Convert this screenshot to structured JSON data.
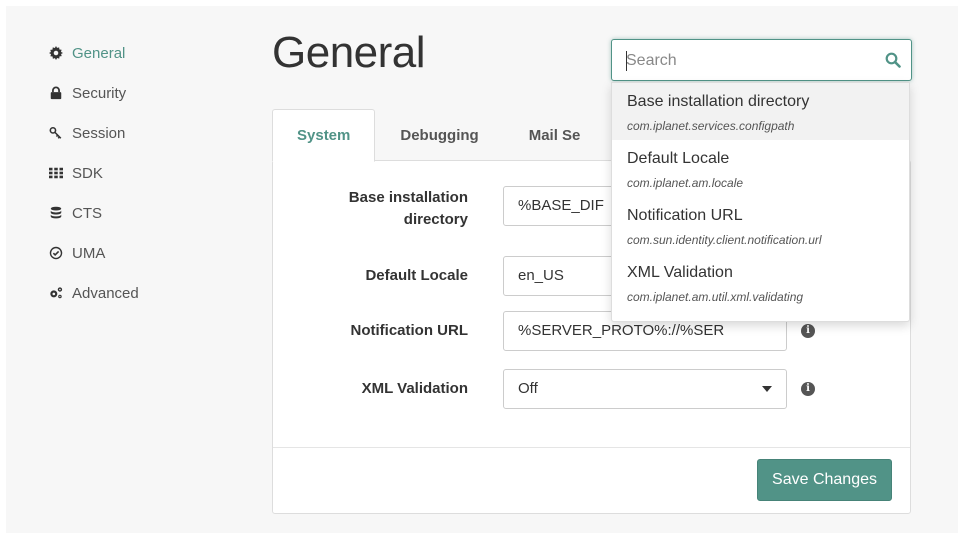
{
  "sidebar": {
    "items": [
      {
        "label": "General",
        "icon": "gear-icon"
      },
      {
        "label": "Security",
        "icon": "lock-icon"
      },
      {
        "label": "Session",
        "icon": "key-icon"
      },
      {
        "label": "SDK",
        "icon": "grid-icon"
      },
      {
        "label": "CTS",
        "icon": "database-icon"
      },
      {
        "label": "UMA",
        "icon": "check-circle-icon"
      },
      {
        "label": "Advanced",
        "icon": "gears-icon"
      }
    ],
    "active_index": 0
  },
  "page": {
    "title": "General"
  },
  "tabs": [
    {
      "label": "System"
    },
    {
      "label": "Debugging"
    },
    {
      "label": "Mail Se"
    }
  ],
  "form": {
    "base_dir": {
      "label_line1": "Base installation",
      "label_line2": "directory",
      "value": "%BASE_DIF"
    },
    "locale": {
      "label": "Default Locale",
      "value": "en_US"
    },
    "notification": {
      "label": "Notification URL",
      "value": "%SERVER_PROTO%://%SER"
    },
    "xml": {
      "label": "XML Validation",
      "value": "Off"
    }
  },
  "save_label": "Save Changes",
  "search": {
    "placeholder": "Search",
    "results": [
      {
        "title": "Base installation directory",
        "key": "com.iplanet.services.configpath"
      },
      {
        "title": "Default Locale",
        "key": "com.iplanet.am.locale"
      },
      {
        "title": "Notification URL",
        "key": "com.sun.identity.client.notification.url"
      },
      {
        "title": "XML Validation",
        "key": "com.iplanet.am.util.xml.validating"
      }
    ]
  },
  "colors": {
    "accent": "#519387",
    "text": "#333333",
    "border": "#dddddd"
  }
}
